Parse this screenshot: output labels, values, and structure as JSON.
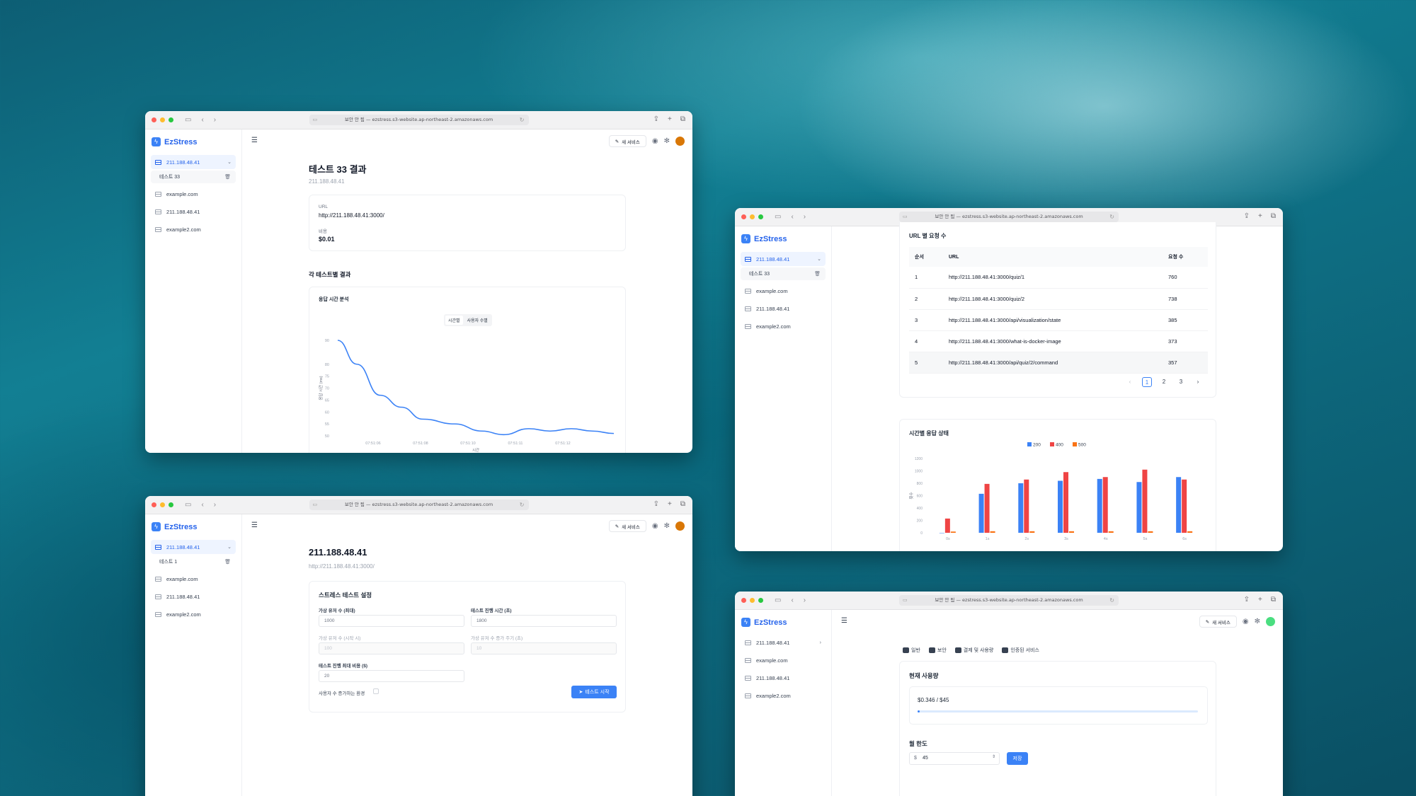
{
  "url_text": "보안 안 됨 — ezstress.s3-website.ap-northeast-2.amazonaws.com",
  "brand": "EzStress",
  "new_service": "새 서비스",
  "nav_items": [
    "211.188.48.41",
    "example.com",
    "211.188.48.41",
    "example2.com"
  ],
  "windows": {
    "result": {
      "sub_item": "테스트 33",
      "title": "테스트 33 결과",
      "subtitle": "211.188.48.41",
      "url_label": "URL",
      "url_value": "http://211.188.48.41:3000/",
      "cost_label": "비용",
      "cost_value": "$0.01",
      "section_title": "각 테스트별 결과",
      "chart_title": "응답 시간 분석",
      "toggle_time": "시간별",
      "toggle_users": "사용자 수별"
    },
    "server": {
      "sub_item": "테스트 1",
      "title": "211.188.48.41",
      "subtitle": "http://211.188.48.41:3000/",
      "form_title": "스트레스 테스트 설정",
      "f1_label": "가상 유저 수 (최대)",
      "f1_value": "1000",
      "f2_label": "테스트 진행 시간 (초)",
      "f2_value": "1800",
      "f3_label": "가상 유저 수 (시작 시)",
      "f3_value": "100",
      "f4_label": "가상 유저 수 증가 주기 (초)",
      "f4_value": "10",
      "f5_label": "테스트 진행 최대 비용 ($)",
      "f5_value": "20",
      "checkbox_label": "사용자 수 증가하는 환경",
      "start_button": "테스트 시작"
    },
    "requests": {
      "sub_item": "테스트 33",
      "table_title": "URL 별 요청 수",
      "col_order": "순서",
      "col_url": "URL",
      "col_count": "요청 수",
      "rows": [
        {
          "order": "1",
          "url": "http://211.188.48.41:3000/quiz/1",
          "count": "760"
        },
        {
          "order": "2",
          "url": "http://211.188.48.41:3000/quiz/2",
          "count": "738"
        },
        {
          "order": "3",
          "url": "http://211.188.48.41:3000/api/visualization/state",
          "count": "385"
        },
        {
          "order": "4",
          "url": "http://211.188.48.41:3000/what-is-docker-image",
          "count": "373"
        },
        {
          "order": "5",
          "url": "http://211.188.48.41:3000/api/quiz/2/command",
          "count": "357"
        }
      ],
      "pages": [
        "1",
        "2",
        "3"
      ],
      "status_title": "시간별 응답 상태"
    },
    "settings": {
      "tabs": [
        "일반",
        "보안",
        "결제 및 사용량",
        "인증된 서비스"
      ],
      "usage_title": "현재 사용량",
      "usage_value": "$0.346 / $45",
      "usage_fraction": 0.0077,
      "limit_title": "월 한도",
      "currency": "$",
      "limit_value": "45",
      "save_button": "저장"
    }
  },
  "chart_data": [
    {
      "type": "line",
      "title": "응답 시간 분석",
      "xlabel": "시간",
      "ylabel": "응답 시간 (ms)",
      "x": [
        "07:51:06",
        "07:51:08",
        "07:51:10",
        "07:51:11",
        "07:51:12"
      ],
      "y_ticks": [
        90,
        80,
        75,
        70,
        65,
        60,
        55,
        50
      ],
      "ylim": [
        50,
        90
      ],
      "points": [
        [
          0,
          90
        ],
        [
          0.09,
          80
        ],
        [
          0.2,
          67
        ],
        [
          0.3,
          62
        ],
        [
          0.4,
          57
        ],
        [
          0.55,
          55
        ],
        [
          0.68,
          52
        ],
        [
          0.78,
          50.5
        ],
        [
          0.9,
          53
        ],
        [
          1.0,
          52
        ],
        [
          1.1,
          53
        ],
        [
          1.2,
          52
        ],
        [
          1.3,
          51
        ]
      ],
      "color": "#3b82f6"
    },
    {
      "type": "bar",
      "title": "시간별 응답 상태",
      "ylabel": "횟수",
      "categories": [
        "0s",
        "1s",
        "2s",
        "3s",
        "4s",
        "5s",
        "6s"
      ],
      "ylim": [
        0,
        1200
      ],
      "y_ticks": [
        0,
        200,
        400,
        600,
        800,
        1000,
        1200
      ],
      "legend_position": "top",
      "series": [
        {
          "name": "200",
          "color": "#3b82f6",
          "values": [
            0,
            630,
            800,
            840,
            870,
            820,
            900
          ]
        },
        {
          "name": "400",
          "color": "#ef4444",
          "values": [
            230,
            790,
            860,
            980,
            900,
            1020,
            860
          ]
        },
        {
          "name": "500",
          "color": "#f97316",
          "values": [
            20,
            25,
            25,
            25,
            25,
            25,
            25
          ]
        }
      ]
    }
  ]
}
